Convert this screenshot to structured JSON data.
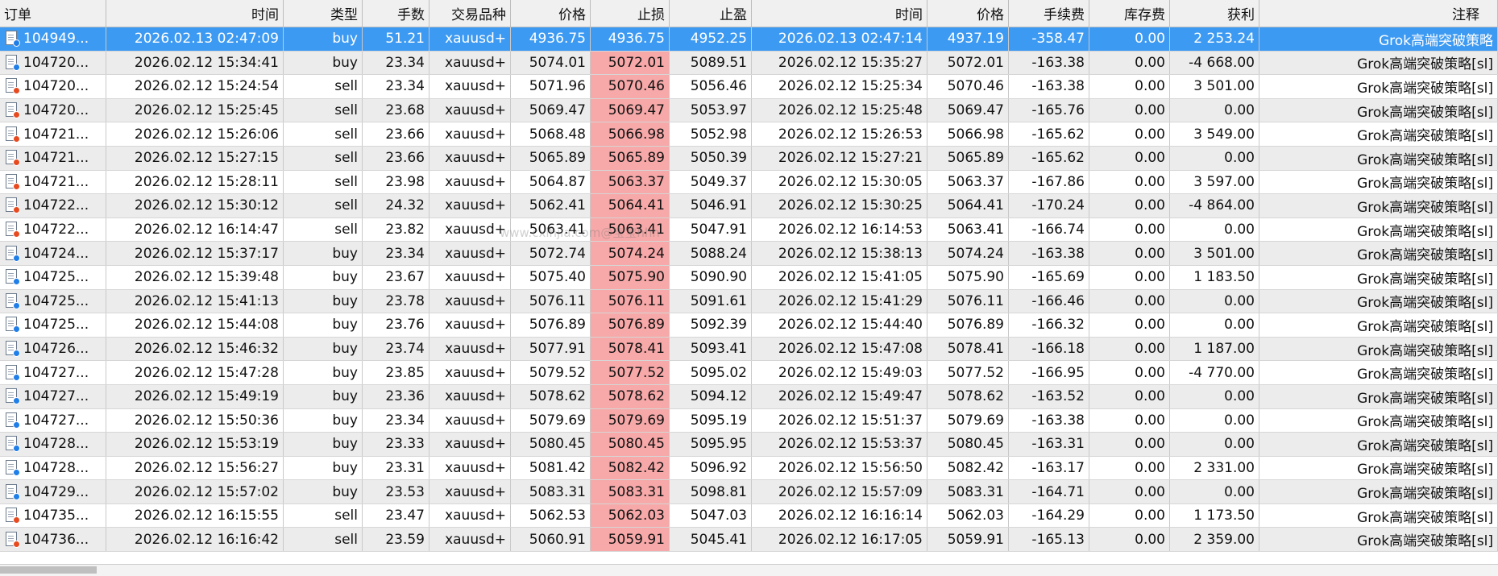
{
  "columns": [
    "订单",
    "时间",
    "类型",
    "手数",
    "交易品种",
    "价格",
    "止损",
    "止盈",
    "时间",
    "价格",
    "手续费",
    "库存费",
    "获利",
    "注释"
  ],
  "rows": [
    {
      "order": "104949...",
      "open_time": "2026.02.13 02:47:09",
      "type": "buy",
      "lots": "51.21",
      "symbol": "xauusd+",
      "price": "4936.75",
      "sl": "4936.75",
      "tp": "4952.25",
      "close_time": "2026.02.13 02:47:14",
      "close_price": "4937.19",
      "commission": "-358.47",
      "swap": "0.00",
      "profit": "2 253.24",
      "comment": "Grok高端突破策略"
    },
    {
      "order": "104720...",
      "open_time": "2026.02.12 15:34:41",
      "type": "buy",
      "lots": "23.34",
      "symbol": "xauusd+",
      "price": "5074.01",
      "sl": "5072.01",
      "tp": "5089.51",
      "close_time": "2026.02.12 15:35:27",
      "close_price": "5072.01",
      "commission": "-163.38",
      "swap": "0.00",
      "profit": "-4 668.00",
      "comment": "Grok高端突破策略[sl]"
    },
    {
      "order": "104720...",
      "open_time": "2026.02.12 15:24:54",
      "type": "sell",
      "lots": "23.34",
      "symbol": "xauusd+",
      "price": "5071.96",
      "sl": "5070.46",
      "tp": "5056.46",
      "close_time": "2026.02.12 15:25:34",
      "close_price": "5070.46",
      "commission": "-163.38",
      "swap": "0.00",
      "profit": "3 501.00",
      "comment": "Grok高端突破策略[sl]"
    },
    {
      "order": "104720...",
      "open_time": "2026.02.12 15:25:45",
      "type": "sell",
      "lots": "23.68",
      "symbol": "xauusd+",
      "price": "5069.47",
      "sl": "5069.47",
      "tp": "5053.97",
      "close_time": "2026.02.12 15:25:48",
      "close_price": "5069.47",
      "commission": "-165.76",
      "swap": "0.00",
      "profit": "0.00",
      "comment": "Grok高端突破策略[sl]"
    },
    {
      "order": "104721...",
      "open_time": "2026.02.12 15:26:06",
      "type": "sell",
      "lots": "23.66",
      "symbol": "xauusd+",
      "price": "5068.48",
      "sl": "5066.98",
      "tp": "5052.98",
      "close_time": "2026.02.12 15:26:53",
      "close_price": "5066.98",
      "commission": "-165.62",
      "swap": "0.00",
      "profit": "3 549.00",
      "comment": "Grok高端突破策略[sl]"
    },
    {
      "order": "104721...",
      "open_time": "2026.02.12 15:27:15",
      "type": "sell",
      "lots": "23.66",
      "symbol": "xauusd+",
      "price": "5065.89",
      "sl": "5065.89",
      "tp": "5050.39",
      "close_time": "2026.02.12 15:27:21",
      "close_price": "5065.89",
      "commission": "-165.62",
      "swap": "0.00",
      "profit": "0.00",
      "comment": "Grok高端突破策略[sl]"
    },
    {
      "order": "104721...",
      "open_time": "2026.02.12 15:28:11",
      "type": "sell",
      "lots": "23.98",
      "symbol": "xauusd+",
      "price": "5064.87",
      "sl": "5063.37",
      "tp": "5049.37",
      "close_time": "2026.02.12 15:30:05",
      "close_price": "5063.37",
      "commission": "-167.86",
      "swap": "0.00",
      "profit": "3 597.00",
      "comment": "Grok高端突破策略[sl]"
    },
    {
      "order": "104722...",
      "open_time": "2026.02.12 15:30:12",
      "type": "sell",
      "lots": "24.32",
      "symbol": "xauusd+",
      "price": "5062.41",
      "sl": "5064.41",
      "tp": "5046.91",
      "close_time": "2026.02.12 15:30:25",
      "close_price": "5064.41",
      "commission": "-170.24",
      "swap": "0.00",
      "profit": "-4 864.00",
      "comment": "Grok高端突破策略[sl]"
    },
    {
      "order": "104722...",
      "open_time": "2026.02.12 16:14:47",
      "type": "sell",
      "lots": "23.82",
      "symbol": "xauusd+",
      "price": "5063.41",
      "sl": "5063.41",
      "tp": "5047.91",
      "close_time": "2026.02.12 16:14:53",
      "close_price": "5063.41",
      "commission": "-166.74",
      "swap": "0.00",
      "profit": "0.00",
      "comment": "Grok高端突破策略[sl]"
    },
    {
      "order": "104724...",
      "open_time": "2026.02.12 15:37:17",
      "type": "buy",
      "lots": "23.34",
      "symbol": "xauusd+",
      "price": "5072.74",
      "sl": "5074.24",
      "tp": "5088.24",
      "close_time": "2026.02.12 15:38:13",
      "close_price": "5074.24",
      "commission": "-163.38",
      "swap": "0.00",
      "profit": "3 501.00",
      "comment": "Grok高端突破策略[sl]"
    },
    {
      "order": "104725...",
      "open_time": "2026.02.12 15:39:48",
      "type": "buy",
      "lots": "23.67",
      "symbol": "xauusd+",
      "price": "5075.40",
      "sl": "5075.90",
      "tp": "5090.90",
      "close_time": "2026.02.12 15:41:05",
      "close_price": "5075.90",
      "commission": "-165.69",
      "swap": "0.00",
      "profit": "1 183.50",
      "comment": "Grok高端突破策略[sl]"
    },
    {
      "order": "104725...",
      "open_time": "2026.02.12 15:41:13",
      "type": "buy",
      "lots": "23.78",
      "symbol": "xauusd+",
      "price": "5076.11",
      "sl": "5076.11",
      "tp": "5091.61",
      "close_time": "2026.02.12 15:41:29",
      "close_price": "5076.11",
      "commission": "-166.46",
      "swap": "0.00",
      "profit": "0.00",
      "comment": "Grok高端突破策略[sl]"
    },
    {
      "order": "104725...",
      "open_time": "2026.02.12 15:44:08",
      "type": "buy",
      "lots": "23.76",
      "symbol": "xauusd+",
      "price": "5076.89",
      "sl": "5076.89",
      "tp": "5092.39",
      "close_time": "2026.02.12 15:44:40",
      "close_price": "5076.89",
      "commission": "-166.32",
      "swap": "0.00",
      "profit": "0.00",
      "comment": "Grok高端突破策略[sl]"
    },
    {
      "order": "104726...",
      "open_time": "2026.02.12 15:46:32",
      "type": "buy",
      "lots": "23.74",
      "symbol": "xauusd+",
      "price": "5077.91",
      "sl": "5078.41",
      "tp": "5093.41",
      "close_time": "2026.02.12 15:47:08",
      "close_price": "5078.41",
      "commission": "-166.18",
      "swap": "0.00",
      "profit": "1 187.00",
      "comment": "Grok高端突破策略[sl]"
    },
    {
      "order": "104727...",
      "open_time": "2026.02.12 15:47:28",
      "type": "buy",
      "lots": "23.85",
      "symbol": "xauusd+",
      "price": "5079.52",
      "sl": "5077.52",
      "tp": "5095.02",
      "close_time": "2026.02.12 15:49:03",
      "close_price": "5077.52",
      "commission": "-166.95",
      "swap": "0.00",
      "profit": "-4 770.00",
      "comment": "Grok高端突破策略[sl]"
    },
    {
      "order": "104727...",
      "open_time": "2026.02.12 15:49:19",
      "type": "buy",
      "lots": "23.36",
      "symbol": "xauusd+",
      "price": "5078.62",
      "sl": "5078.62",
      "tp": "5094.12",
      "close_time": "2026.02.12 15:49:47",
      "close_price": "5078.62",
      "commission": "-163.52",
      "swap": "0.00",
      "profit": "0.00",
      "comment": "Grok高端突破策略[sl]"
    },
    {
      "order": "104727...",
      "open_time": "2026.02.12 15:50:36",
      "type": "buy",
      "lots": "23.34",
      "symbol": "xauusd+",
      "price": "5079.69",
      "sl": "5079.69",
      "tp": "5095.19",
      "close_time": "2026.02.12 15:51:37",
      "close_price": "5079.69",
      "commission": "-163.38",
      "swap": "0.00",
      "profit": "0.00",
      "comment": "Grok高端突破策略[sl]"
    },
    {
      "order": "104728...",
      "open_time": "2026.02.12 15:53:19",
      "type": "buy",
      "lots": "23.33",
      "symbol": "xauusd+",
      "price": "5080.45",
      "sl": "5080.45",
      "tp": "5095.95",
      "close_time": "2026.02.12 15:53:37",
      "close_price": "5080.45",
      "commission": "-163.31",
      "swap": "0.00",
      "profit": "0.00",
      "comment": "Grok高端突破策略[sl]"
    },
    {
      "order": "104728...",
      "open_time": "2026.02.12 15:56:27",
      "type": "buy",
      "lots": "23.31",
      "symbol": "xauusd+",
      "price": "5081.42",
      "sl": "5082.42",
      "tp": "5096.92",
      "close_time": "2026.02.12 15:56:50",
      "close_price": "5082.42",
      "commission": "-163.17",
      "swap": "0.00",
      "profit": "2 331.00",
      "comment": "Grok高端突破策略[sl]"
    },
    {
      "order": "104729...",
      "open_time": "2026.02.12 15:57:02",
      "type": "buy",
      "lots": "23.53",
      "symbol": "xauusd+",
      "price": "5083.31",
      "sl": "5083.31",
      "tp": "5098.81",
      "close_time": "2026.02.12 15:57:09",
      "close_price": "5083.31",
      "commission": "-164.71",
      "swap": "0.00",
      "profit": "0.00",
      "comment": "Grok高端突破策略[sl]"
    },
    {
      "order": "104735...",
      "open_time": "2026.02.12 16:15:55",
      "type": "sell",
      "lots": "23.47",
      "symbol": "xauusd+",
      "price": "5062.53",
      "sl": "5062.03",
      "tp": "5047.03",
      "close_time": "2026.02.12 16:16:14",
      "close_price": "5062.03",
      "commission": "-164.29",
      "swap": "0.00",
      "profit": "1 173.50",
      "comment": "Grok高端突破策略[sl]"
    },
    {
      "order": "104736...",
      "open_time": "2026.02.12 16:16:42",
      "type": "sell",
      "lots": "23.59",
      "symbol": "xauusd+",
      "price": "5060.91",
      "sl": "5059.91",
      "tp": "5045.41",
      "close_time": "2026.02.12 16:17:05",
      "close_price": "5059.91",
      "commission": "-165.13",
      "swap": "0.00",
      "profit": "2 359.00",
      "comment": "Grok高端突破策略[sl]"
    }
  ],
  "watermark": "www.cxihjia.com@宝宝hhh",
  "colors": {
    "selected_row": "#3d9af2",
    "sl_highlight": "#f7a8a8",
    "alt_row": "#ececec",
    "header_bg": "#f0f0f0",
    "buy_dot": "#1f7ee8",
    "sell_dot": "#e84a1f"
  }
}
